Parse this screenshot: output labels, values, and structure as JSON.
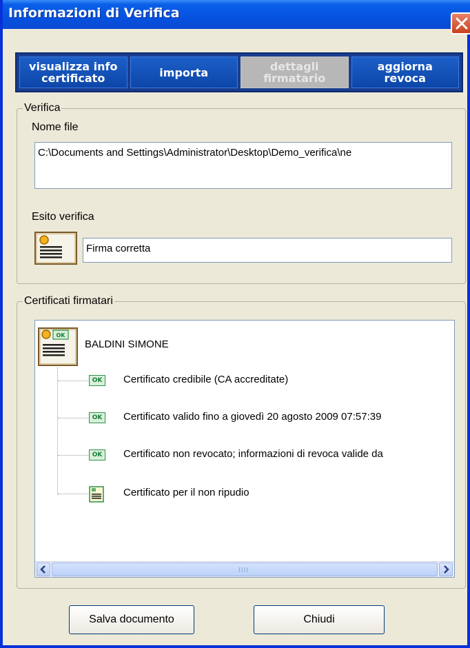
{
  "window": {
    "title": "Informazioni di Verifica",
    "close_icon": "close-icon"
  },
  "tabs": [
    {
      "label": "visualizza info\ncertificato",
      "enabled": true
    },
    {
      "label": "importa",
      "enabled": true
    },
    {
      "label": "dettagli\nfirmatario",
      "enabled": false
    },
    {
      "label": "aggiorna\nrevoca",
      "enabled": true
    }
  ],
  "verifica": {
    "legend": "Verifica",
    "file_label": "Nome file",
    "file_value": "C:\\Documents and Settings\\Administrator\\Desktop\\Demo_verifica\\ne",
    "esito_label": "Esito verifica",
    "esito_value": "Firma corretta",
    "esito_icon": "signed-document-icon"
  },
  "certificati": {
    "legend": "Certificati firmatari",
    "signer": {
      "name": "BALDINI SIMONE",
      "icon": "signer-certificate-ok-icon"
    },
    "items": [
      {
        "icon": "ok-icon",
        "text": "Certificato credibile (CA accreditate)"
      },
      {
        "icon": "ok-icon",
        "text": "Certificato valido fino a giovedì 20 agosto 2009  07:57:39"
      },
      {
        "icon": "ok-icon",
        "text": "Certificato non revocato; informazioni di revoca valide da"
      },
      {
        "icon": "certificate-icon",
        "text": "Certificato per il non ripudio"
      }
    ],
    "ok_badge": "OK"
  },
  "buttons": {
    "save": "Salva documento",
    "close": "Chiudi"
  },
  "colors": {
    "titlebar": "#0552e0",
    "tab_bg": "#0d46a8",
    "tab_disabled": "#b7b7b7",
    "window_bg": "#ece9d8"
  }
}
